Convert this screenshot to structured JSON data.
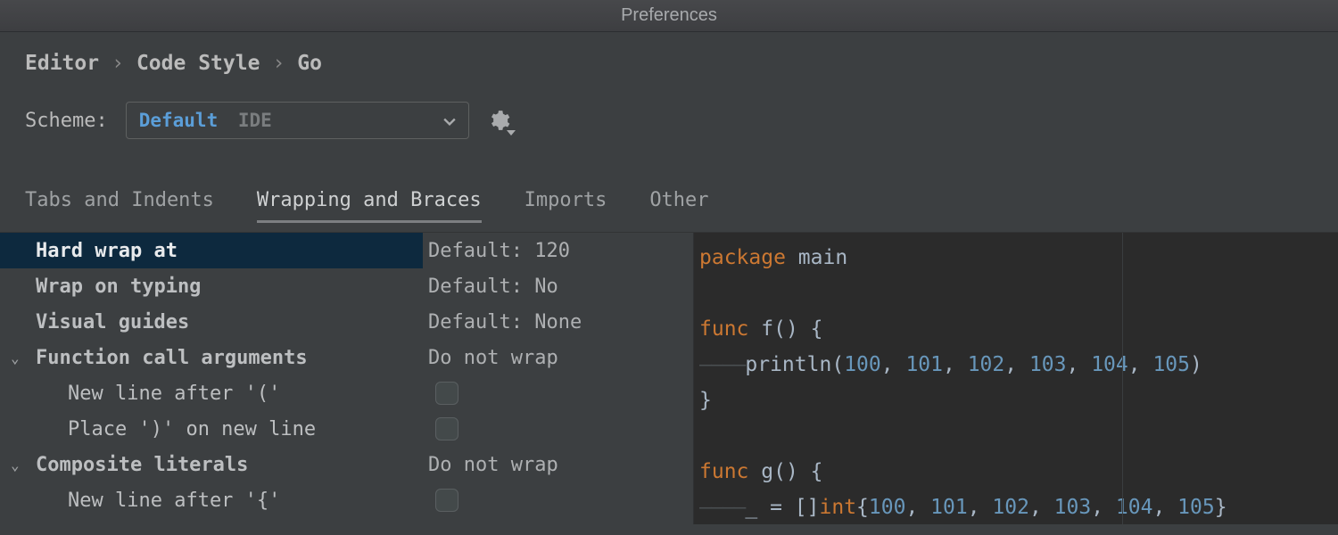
{
  "window": {
    "title": "Preferences"
  },
  "breadcrumb": {
    "a": "Editor",
    "b": "Code Style",
    "c": "Go",
    "sep": "›"
  },
  "scheme": {
    "label": "Scheme:",
    "value": "Default",
    "tag": "IDE"
  },
  "tabs": {
    "t0": "Tabs and Indents",
    "t1": "Wrapping and Braces",
    "t2": "Imports",
    "t3": "Other",
    "active": 1
  },
  "settings": {
    "r0": {
      "label": "Hard wrap at",
      "value": "Default: 120"
    },
    "r1": {
      "label": "Wrap on typing",
      "value": "Default: No"
    },
    "r2": {
      "label": "Visual guides",
      "value": "Default: None"
    },
    "r3": {
      "label": "Function call arguments",
      "value": "Do not wrap"
    },
    "r3a": {
      "label": "New line after '('"
    },
    "r3b": {
      "label": "Place ')' on new line"
    },
    "r4": {
      "label": "Composite literals",
      "value": "Do not wrap"
    },
    "r4a": {
      "label": "New line after '{'"
    }
  },
  "preview": {
    "kw_package": "package",
    "main": "main",
    "kw_func": "func",
    "f_name": "f",
    "g_name": "g",
    "println": "println",
    "int_kw": "int",
    "nums": {
      "n0": "100",
      "n1": "101",
      "n2": "102",
      "n3": "103",
      "n4": "104",
      "n5": "105"
    }
  }
}
